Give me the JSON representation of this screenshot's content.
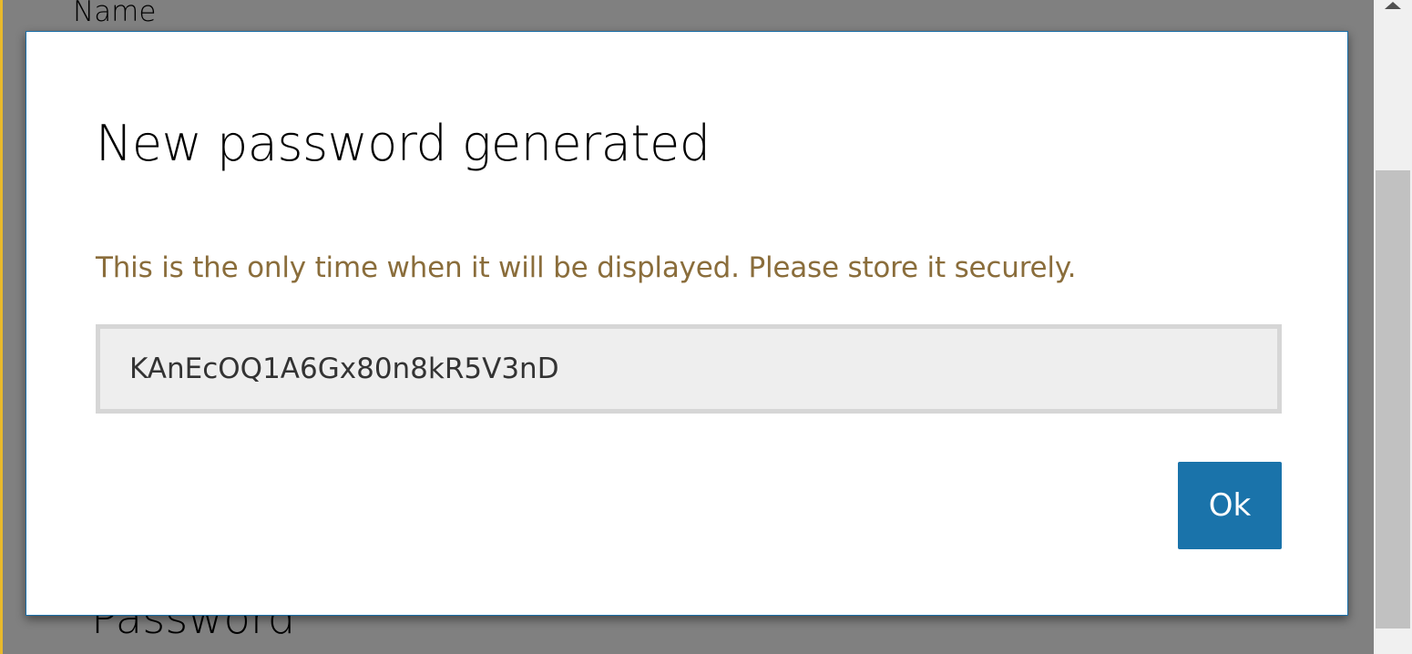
{
  "background": {
    "name_label": "Name",
    "password_label": "Password"
  },
  "dialog": {
    "title": "New password generated",
    "warning": "This is the only time when it will be displayed. Please store it securely.",
    "password_value": "KAnEcOQ1A6Gx80n8kR5V3nD",
    "ok_label": "Ok"
  },
  "colors": {
    "overlay": "#808080",
    "warning_text": "#8a6d3b",
    "button_bg": "#1a73aa",
    "dialog_border": "#1a6fa8",
    "field_bg": "#eeeeee"
  }
}
